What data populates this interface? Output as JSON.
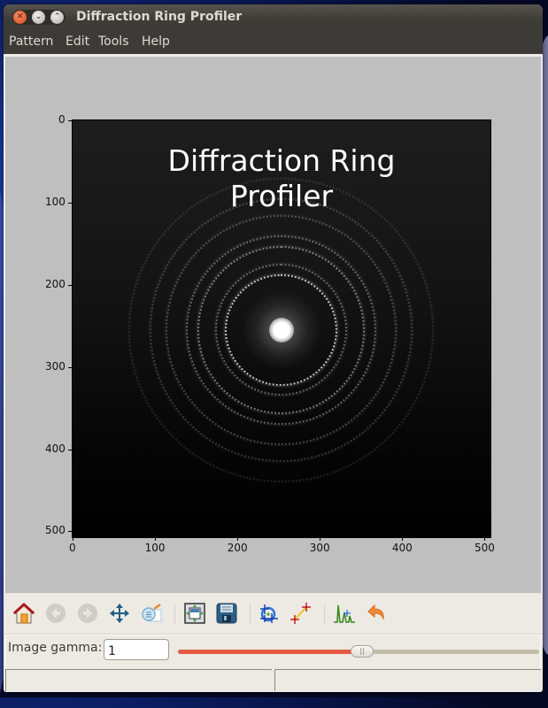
{
  "window": {
    "title": "Diffraction Ring Profiler",
    "controls": [
      "close",
      "minimize",
      "maximize"
    ]
  },
  "menubar": {
    "items": [
      "Pattern",
      "Edit",
      "Tools",
      "Help"
    ]
  },
  "chart_data": {
    "type": "heatmap",
    "title": "Diffraction Ring Profiler",
    "description": "Grayscale electron diffraction pattern image with concentric rings around a bright central beam",
    "xlabel": "",
    "ylabel": "",
    "xlim": [
      0,
      507
    ],
    "ylim": [
      507,
      0
    ],
    "x_ticks": [
      "0",
      "100",
      "200",
      "300",
      "400",
      "500"
    ],
    "y_ticks": [
      "0",
      "100",
      "200",
      "300",
      "400",
      "500"
    ],
    "x_tick_values": [
      0,
      100,
      200,
      300,
      400,
      500
    ],
    "y_tick_values": [
      0,
      100,
      200,
      300,
      400,
      500
    ],
    "center": [
      253,
      255
    ],
    "ring_radii": [
      68,
      80,
      102,
      115,
      140,
      160,
      185
    ],
    "ring_intensity": [
      0.75,
      0.35,
      0.45,
      0.35,
      0.25,
      0.2,
      0.12
    ],
    "colormap": "gray",
    "grid": false
  },
  "toolbar": {
    "buttons": [
      {
        "name": "home",
        "icon": "home-icon",
        "enabled": true
      },
      {
        "name": "back",
        "icon": "back-arrow-icon",
        "enabled": false
      },
      {
        "name": "forward",
        "icon": "forward-arrow-icon",
        "enabled": false
      },
      {
        "name": "pan",
        "icon": "pan-arrows-icon",
        "enabled": true
      },
      {
        "name": "zoom",
        "icon": "zoom-magnifier-icon",
        "enabled": true
      },
      {
        "name": "configure-subplots",
        "icon": "subplots-icon",
        "enabled": true
      },
      {
        "name": "save",
        "icon": "floppy-disk-icon",
        "enabled": true
      },
      {
        "name": "find-center",
        "icon": "crosshair-circle-icon",
        "enabled": true
      },
      {
        "name": "calibrate",
        "icon": "line-measure-icon",
        "enabled": true
      },
      {
        "name": "profile",
        "icon": "peak-profile-icon",
        "enabled": true
      },
      {
        "name": "undo",
        "icon": "undo-arrow-icon",
        "enabled": true
      }
    ]
  },
  "gamma": {
    "label": "Image gamma:",
    "value": "1",
    "slider_fraction": 0.51
  },
  "statusbar": {
    "left": "",
    "right": ""
  }
}
